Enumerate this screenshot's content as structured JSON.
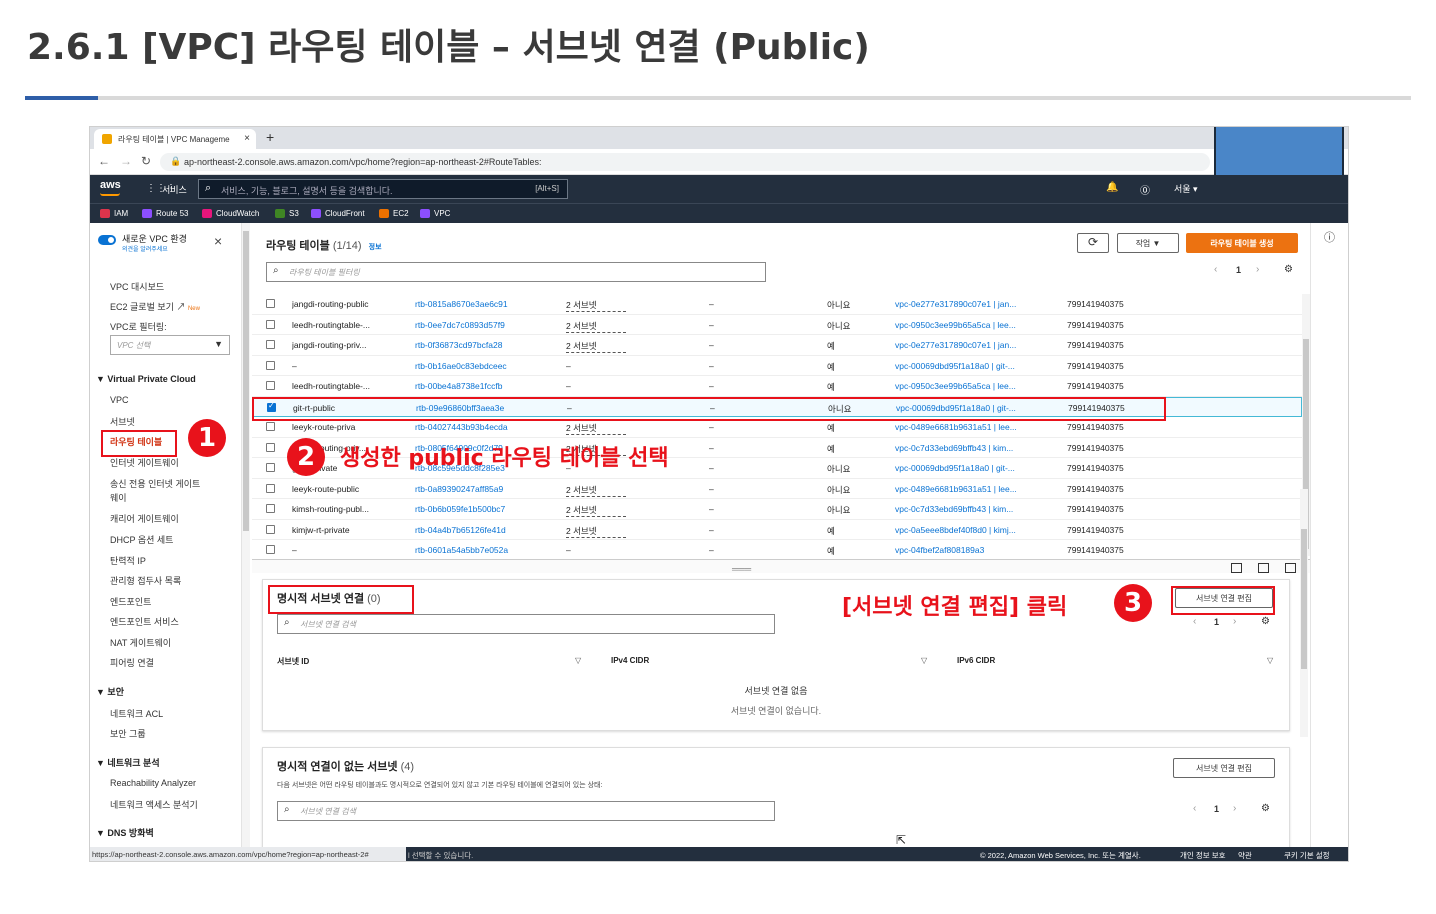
{
  "slide": {
    "title": "2.6.1 [VPC] 라우팅 테이블 – 서브넷 연결 (Public)"
  },
  "browser": {
    "tab_title": "라우팅 테이블 | VPC Manageme",
    "tab_close": "×",
    "new_tab": "+",
    "url": "ap-northeast-2.console.aws.amazon.com/vpc/home?region=ap-northeast-2#RouteTables:"
  },
  "awsnav": {
    "logo": "aws",
    "services": "서비스",
    "search_placeholder": "서비스, 기능, 블로그, 설명서 등을 검색합니다.",
    "search_shortcut": "[Alt+S]",
    "region": "서울 ▾"
  },
  "favorites": [
    {
      "label": "IAM",
      "color": "#dd344c"
    },
    {
      "label": "Route 53",
      "color": "#8c4fff"
    },
    {
      "label": "CloudWatch",
      "color": "#e7157b"
    },
    {
      "label": "S3",
      "color": "#3f8624"
    },
    {
      "label": "CloudFront",
      "color": "#8c4fff"
    },
    {
      "label": "EC2",
      "color": "#ed7100"
    },
    {
      "label": "VPC",
      "color": "#8c4fff"
    }
  ],
  "sidebar": {
    "header": "새로운 VPC 환경",
    "subheader": "의견을 알려주세요",
    "close": "×",
    "dashboard": "VPC 대시보드",
    "ec2_global": "EC2 글로벌 보기",
    "ec2_global_badge": "New",
    "filter_label": "VPC로 필터링:",
    "filter_placeholder": "VPC 선택",
    "section_vpc": "Virtual Private Cloud",
    "vpc_items": [
      "VPC",
      "서브넷",
      "라우팅 테이블",
      "인터넷 게이트웨이",
      "송신 전용 인터넷 게이트",
      "웨이",
      "캐리어 게이트웨이",
      "DHCP 옵션 세트",
      "탄력적 IP",
      "관리형 접두사 목록",
      "엔드포인트",
      "엔드포인트 서비스",
      "NAT 게이트웨이",
      "피어링 연결"
    ],
    "section_security": "보안",
    "security_items": [
      "네트워크 ACL",
      "보안 그룹"
    ],
    "section_analysis": "네트워크 분석",
    "analysis_items": [
      "Reachability Analyzer",
      "네트워크 액세스 분석기"
    ],
    "section_dns": "DNS 방화벽"
  },
  "route_tables": {
    "title": "라우팅 테이블",
    "count": "(1/14)",
    "info": "정보",
    "refresh": "⟳",
    "actions": "작업 ▼",
    "create": "라우팅 테이블 생성",
    "filter_placeholder": "라우팅 테이블 필터링",
    "page": "1",
    "rows": [
      {
        "name": "jangdi-routing-public",
        "id": "rtb-0815a8670e3ae6c91",
        "assoc": "2 서브넷",
        "edge": "–",
        "main": "아니요",
        "vpc": "vpc-0e277e317890c07e1 | jan...",
        "owner": "799141940375",
        "checked": false
      },
      {
        "name": "leedh-routingtable-...",
        "id": "rtb-0ee7dc7c0893d57f9",
        "assoc": "2 서브넷",
        "edge": "–",
        "main": "아니요",
        "vpc": "vpc-0950c3ee99b65a5ca | lee...",
        "owner": "799141940375",
        "checked": false
      },
      {
        "name": "jangdi-routing-priv...",
        "id": "rtb-0f36873cd97bcfa28",
        "assoc": "2 서브넷",
        "edge": "–",
        "main": "예",
        "vpc": "vpc-0e277e317890c07e1 | jan...",
        "owner": "799141940375",
        "checked": false
      },
      {
        "name": "–",
        "id": "rtb-0b16ae0c83ebdceec",
        "assoc": "–",
        "edge": "–",
        "main": "예",
        "vpc": "vpc-00069dbd95f1a18a0 | git-...",
        "owner": "799141940375",
        "checked": false
      },
      {
        "name": "leedh-routingtable-...",
        "id": "rtb-00be4a8738e1fccfb",
        "assoc": "–",
        "edge": "–",
        "main": "예",
        "vpc": "vpc-0950c3ee99b65a5ca | lee...",
        "owner": "799141940375",
        "checked": false
      },
      {
        "name": "git-rt-public",
        "id": "rtb-09e96860bff3aea3e",
        "assoc": "–",
        "edge": "–",
        "main": "아니요",
        "vpc": "vpc-00069dbd95f1a18a0 | git-...",
        "owner": "799141940375",
        "checked": true
      },
      {
        "name": "leeyk-route-priva",
        "id": "rtb-04027443b93b4ecda",
        "assoc": "2 서브넷",
        "edge": "–",
        "main": "예",
        "vpc": "vpc-0489e6681b9631a51 | lee...",
        "owner": "799141940375",
        "checked": false
      },
      {
        "name": "kimsh-routing-priv...",
        "id": "rtb-0805f64909c0f2d79",
        "assoc": "2 서브넷",
        "edge": "–",
        "main": "예",
        "vpc": "vpc-0c7d33ebd69bffb43 | kim...",
        "owner": "799141940375",
        "checked": false
      },
      {
        "name": "git-rt-private",
        "id": "rtb-08c59e5ddc8f285e3",
        "assoc": "–",
        "edge": "–",
        "main": "아니요",
        "vpc": "vpc-00069dbd95f1a18a0 | git-...",
        "owner": "799141940375",
        "checked": false
      },
      {
        "name": "leeyk-route-public",
        "id": "rtb-0a89390247aff85a9",
        "assoc": "2 서브넷",
        "edge": "–",
        "main": "아니요",
        "vpc": "vpc-0489e6681b9631a51 | lee...",
        "owner": "799141940375",
        "checked": false
      },
      {
        "name": "kimsh-routing-publ...",
        "id": "rtb-0b6b059fe1b500bc7",
        "assoc": "2 서브넷",
        "edge": "–",
        "main": "아니요",
        "vpc": "vpc-0c7d33ebd69bffb43 | kim...",
        "owner": "799141940375",
        "checked": false
      },
      {
        "name": "kimjw-rt-private",
        "id": "rtb-04a4b7b65126fe41d",
        "assoc": "2 서브넷",
        "edge": "–",
        "main": "예",
        "vpc": "vpc-0a5eee8bdef40f8d0 | kimj...",
        "owner": "799141940375",
        "checked": false
      },
      {
        "name": "–",
        "id": "rtb-0601a54a5bb7e052a",
        "assoc": "–",
        "edge": "–",
        "main": "예",
        "vpc": "vpc-04fbef2af808189a3",
        "owner": "799141940375",
        "checked": false
      }
    ]
  },
  "explicit_assoc": {
    "title": "명시적 서브넷 연결",
    "count": "(0)",
    "edit_button": "서브넷 연결 편집",
    "search_placeholder": "서브넷 연결 검색",
    "page": "1",
    "col_subnet": "서브넷 ID",
    "col_ipv4": "IPv4 CIDR",
    "col_ipv6": "IPv6 CIDR",
    "empty_title": "서브넷 연결 없음",
    "empty_desc": "서브넷 연결이 없습니다."
  },
  "no_explicit": {
    "title": "명시적 연결이 없는 서브넷",
    "count": "(4)",
    "desc": "다음 서브넷은 어떤 라우팅 테이블과도 명시적으로 연결되어 있지 않고 기본 라우팅 테이블에 연결되어 있는 상태:",
    "edit_button": "서브넷 연결 편집",
    "search_placeholder": "서브넷 연결 검색",
    "page": "1"
  },
  "statusbar": {
    "hover_url": "https://ap-northeast-2.console.aws.amazon.com/vpc/home?region=ap-northeast-2#",
    "left_text": "l 선택할 수 있습니다.",
    "copyright": "© 2022, Amazon Web Services, Inc. 또는 계열사.",
    "privacy": "개인 정보 보호",
    "terms": "약관",
    "cookies": "쿠키 기본 설정"
  },
  "annotations": {
    "step1": "1",
    "step2": "2",
    "step2_text": "생성한 public 라우팅 테이블 선택",
    "step3": "3",
    "step3_text": "[서브넷 연결 편집] 클릭"
  }
}
